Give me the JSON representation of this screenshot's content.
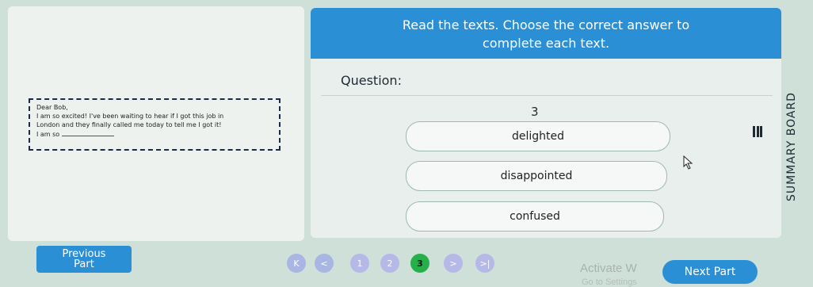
{
  "header": {
    "line1": "Read the texts. Choose the correct answer to",
    "line2": "complete each text."
  },
  "question": {
    "label": "Question:",
    "number": "3"
  },
  "letter": {
    "greeting": "Dear Bob,",
    "line1": "I am so excited! I've been waiting to hear if I got this job in",
    "line2": "London and they finally called me today to tell me I got it!",
    "line3_prefix": "I am so"
  },
  "options": [
    "delighted",
    "disappointed",
    "confused"
  ],
  "sidebar": {
    "summary_label": "SUMMARY BOARD"
  },
  "navigation": {
    "previous_line1": "Previous",
    "previous_line2": "Part",
    "next": "Next Part",
    "first_symbol": "K",
    "prev_symbol": "<",
    "pages": [
      "1",
      "2",
      "3"
    ],
    "current_page": "3",
    "next_symbol": ">",
    "last_symbol": ">|"
  },
  "watermark": {
    "line1": "Activate W",
    "line2": "Go to Settings"
  },
  "colors": {
    "accent": "#2b8fd6",
    "current_page": "#26b04a",
    "background": "#cfe0d9"
  },
  "icons": [
    "menu-icon",
    "cursor-icon"
  ]
}
